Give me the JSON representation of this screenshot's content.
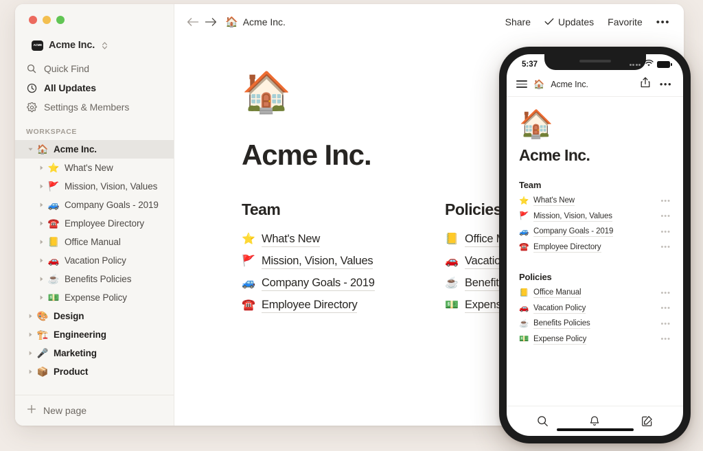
{
  "window": {
    "traffic_lights": [
      "close",
      "minimize",
      "zoom"
    ]
  },
  "sidebar": {
    "workspace_switcher": {
      "logo_text": "ACME",
      "name": "Acme Inc.",
      "chevron": "⌃⌄"
    },
    "nav": [
      {
        "icon": "search-icon",
        "label": "Quick Find"
      },
      {
        "icon": "clock-icon",
        "label": "All Updates"
      },
      {
        "icon": "gear-icon",
        "label": "Settings & Members"
      }
    ],
    "section_header": "WORKSPACE",
    "tree": [
      {
        "label": "Acme Inc.",
        "emoji": "🏠",
        "level": 0,
        "expanded": true,
        "selected": true
      },
      {
        "label": "What's New",
        "emoji": "⭐",
        "level": 1,
        "expanded": false,
        "selected": false
      },
      {
        "label": "Mission, Vision, Values",
        "emoji": "🚩",
        "level": 1,
        "expanded": false,
        "selected": false
      },
      {
        "label": "Company Goals - 2019",
        "emoji": "🚙",
        "level": 1,
        "expanded": false,
        "selected": false
      },
      {
        "label": "Employee Directory",
        "emoji": "☎️",
        "level": 1,
        "expanded": false,
        "selected": false
      },
      {
        "label": "Office Manual",
        "emoji": "📒",
        "level": 1,
        "expanded": false,
        "selected": false
      },
      {
        "label": "Vacation Policy",
        "emoji": "🚗",
        "level": 1,
        "expanded": false,
        "selected": false
      },
      {
        "label": "Benefits Policies",
        "emoji": "☕",
        "level": 1,
        "expanded": false,
        "selected": false
      },
      {
        "label": "Expense Policy",
        "emoji": "💵",
        "level": 1,
        "expanded": false,
        "selected": false
      },
      {
        "label": "Design",
        "emoji": "🎨",
        "level": 0,
        "expanded": false,
        "selected": false
      },
      {
        "label": "Engineering",
        "emoji": "🏗️",
        "level": 0,
        "expanded": false,
        "selected": false
      },
      {
        "label": "Marketing",
        "emoji": "🎤",
        "level": 0,
        "expanded": false,
        "selected": false
      },
      {
        "label": "Product",
        "emoji": "📦",
        "level": 0,
        "expanded": false,
        "selected": false
      }
    ],
    "footer": {
      "icon": "plus-icon",
      "label": "New page"
    }
  },
  "topbar": {
    "back_icon": "←",
    "forward_icon": "→",
    "breadcrumb": {
      "emoji": "🏠",
      "label": "Acme Inc."
    },
    "share_label": "Share",
    "updates_label": "Updates",
    "updates_check": "✓",
    "favorite_label": "Favorite",
    "more_label": "•••"
  },
  "page": {
    "emoji": "🏠",
    "title": "Acme Inc.",
    "columns": [
      {
        "heading": "Team",
        "links": [
          {
            "emoji": "⭐",
            "label": "What's New"
          },
          {
            "emoji": "🚩",
            "label": "Mission, Vision, Values"
          },
          {
            "emoji": "🚙",
            "label": "Company Goals - 2019"
          },
          {
            "emoji": "☎️",
            "label": "Employee Directory"
          }
        ]
      },
      {
        "heading": "Policies",
        "links": [
          {
            "emoji": "📒",
            "label": "Office Manual"
          },
          {
            "emoji": "🚗",
            "label": "Vacation Policy"
          },
          {
            "emoji": "☕",
            "label": "Benefits Policies"
          },
          {
            "emoji": "💵",
            "label": "Expense Policy"
          }
        ]
      }
    ]
  },
  "phone": {
    "status": {
      "time": "5:37",
      "wifi_icon": "wifi-icon",
      "battery_icon": "battery-icon"
    },
    "header": {
      "menu_icon": "hamburger-icon",
      "emoji": "🏠",
      "title": "Acme Inc.",
      "share_icon": "share-icon",
      "more_icon": "•••"
    },
    "page": {
      "emoji": "🏠",
      "title": "Acme Inc.",
      "sections": [
        {
          "heading": "Team",
          "links": [
            {
              "emoji": "⭐",
              "label": "What's New",
              "more": "•••"
            },
            {
              "emoji": "🚩",
              "label": "Mission, Vision, Values",
              "more": "•••"
            },
            {
              "emoji": "🚙",
              "label": "Company Goals - 2019",
              "more": "•••"
            },
            {
              "emoji": "☎️",
              "label": "Employee Directory",
              "more": "•••"
            }
          ]
        },
        {
          "heading": "Policies",
          "links": [
            {
              "emoji": "📒",
              "label": "Office Manual",
              "more": "•••"
            },
            {
              "emoji": "🚗",
              "label": "Vacation Policy",
              "more": "•••"
            },
            {
              "emoji": "☕",
              "label": "Benefits Policies",
              "more": "•••"
            },
            {
              "emoji": "💵",
              "label": "Expense Policy",
              "more": "•••"
            }
          ]
        }
      ]
    },
    "tabbar": [
      {
        "icon": "search-icon"
      },
      {
        "icon": "bell-icon"
      },
      {
        "icon": "compose-icon"
      }
    ]
  },
  "colors": {
    "page_background": "#f1ebe6",
    "sidebar_background": "#f7f6f3",
    "selected_row": "#e7e5e1",
    "text_primary": "#272522",
    "text_secondary": "#6d6862",
    "traffic_red": "#ec6a5e",
    "traffic_yellow": "#f3bf4f",
    "traffic_green": "#61c554",
    "phone_frame": "#1c1c1c"
  }
}
